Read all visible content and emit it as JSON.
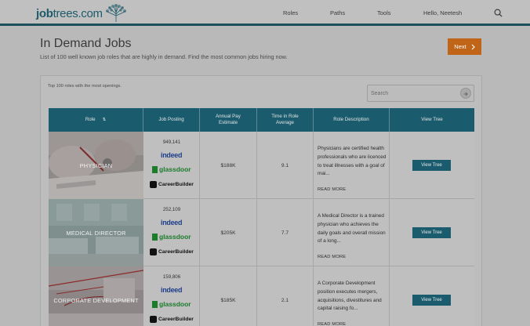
{
  "header": {
    "logo_bold": "job",
    "logo_rest": "trees.com",
    "nav": [
      "Roles",
      "Paths",
      "Tools",
      "Hello, Neetesh"
    ]
  },
  "page": {
    "title": "In Demand Jobs",
    "subtitle": "List of 100 well known job roles that are highly in demand. Find the most common jobs hiring now.",
    "next_label": "Next"
  },
  "panel": {
    "caption": "Top 100 roles with the most openings.",
    "search_placeholder": "Search"
  },
  "table": {
    "columns": [
      "Role",
      "Job Posting",
      "Annual Pay Estimate",
      "Time in Role Average",
      "Role Description",
      "View Tree"
    ],
    "sort_icon": "sort-icon",
    "brands": {
      "indeed": "indeed",
      "glassdoor": "glassdoor",
      "careerbuilder": "CareerBuilder"
    },
    "read_more": "READ MORE",
    "view_tree": "View Tree",
    "rows": [
      {
        "role": "PHYSICIAN",
        "postings": "949,141",
        "pay": "$188K",
        "time": "9.1",
        "description": "Physicians are certified health professionals who are licenced to treat illnesses with a goal of mai..."
      },
      {
        "role": "MEDICAL DIRECTOR",
        "postings": "252,109",
        "pay": "$205K",
        "time": "7.7",
        "description": "A Medical Director is a trained physician who achieves the daily goals and overall mission of a long..."
      },
      {
        "role": "CORPORATE DEVELOPMENT",
        "postings": "159,806",
        "pay": "$185K",
        "time": "2.1",
        "description": "A Corporate Development position executes mergers, acquisitions, divestitures and capital raising fo..."
      }
    ]
  }
}
